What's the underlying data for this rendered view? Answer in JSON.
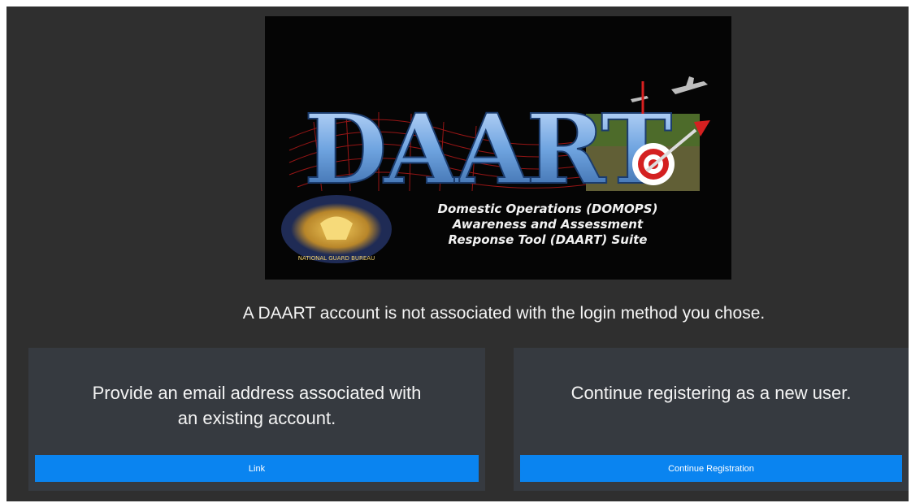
{
  "banner": {
    "logo_text": "DAART",
    "seal_text": "NATIONAL GUARD BUREAU",
    "tagline": [
      "Domestic Operations (DOMOPS)",
      "Awareness and Assessment",
      "Response Tool (DAART) Suite"
    ]
  },
  "message": "A DAART account is not associated with the login method you chose.",
  "options": [
    {
      "text_line1": "Provide an email address associated with",
      "text_line2": "an existing account.",
      "button_label": "Link"
    },
    {
      "text_line1": "Continue registering as a new user.",
      "text_line2": "",
      "button_label": "Continue Registration"
    }
  ],
  "colors": {
    "page_bg": "#2f2f2f",
    "card_bg": "#363a40",
    "button_bg": "#0a84f0",
    "logo_blue": "#7fb2e8"
  }
}
